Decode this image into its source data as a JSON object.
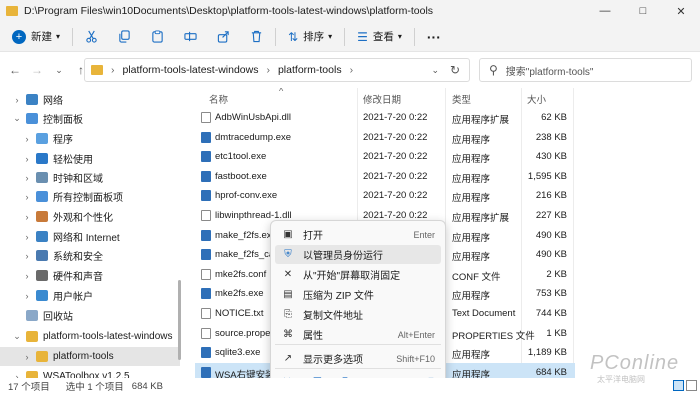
{
  "window": {
    "title": "D:\\Program Files\\win10Documents\\Desktop\\platform-tools-latest-windows\\platform-tools"
  },
  "toolbar": {
    "new_label": "新建",
    "sort_label": "排序",
    "view_label": "查看",
    "more_label": "···"
  },
  "address": {
    "crumb1": "platform-tools-latest-windows",
    "crumb2": "platform-tools",
    "sep": "›",
    "search_placeholder": "搜索\"platform-tools\""
  },
  "sidebar": {
    "items": [
      {
        "label": "网络",
        "color": "#3b82c4",
        "chevron": "›"
      },
      {
        "label": "控制面板",
        "color": "#4a90d9",
        "chevron": "⌄"
      },
      {
        "label": "程序",
        "color": "#5aa0e0",
        "chevron": "›"
      },
      {
        "label": "轻松使用",
        "color": "#2a78c8",
        "chevron": "›"
      },
      {
        "label": "时钟和区域",
        "color": "#6a8fb0",
        "chevron": "›"
      },
      {
        "label": "所有控制面板项",
        "color": "#4a90d9",
        "chevron": "›"
      },
      {
        "label": "外观和个性化",
        "color": "#c87a3a",
        "chevron": "›"
      },
      {
        "label": "网络和 Internet",
        "color": "#3b82c4",
        "chevron": "›"
      },
      {
        "label": "系统和安全",
        "color": "#4a7ab0",
        "chevron": "›"
      },
      {
        "label": "硬件和声音",
        "color": "#6a6a6a",
        "chevron": "›"
      },
      {
        "label": "用户帐户",
        "color": "#3a8ad0",
        "chevron": "›"
      },
      {
        "label": "回收站",
        "color": "#8aa8c8",
        "chevron": ""
      },
      {
        "label": "platform-tools-latest-windows",
        "color": "#e8b43a",
        "chevron": "⌄"
      },
      {
        "label": "platform-tools",
        "color": "#e8b43a",
        "chevron": "›"
      },
      {
        "label": "WSAToolbox v1.2.5",
        "color": "#e8b43a",
        "chevron": "›"
      }
    ]
  },
  "table": {
    "headers": {
      "name": "名称",
      "date": "修改日期",
      "type": "类型",
      "size": "大小"
    },
    "rows": [
      {
        "name": "AdbWinUsbApi.dll",
        "date": "2021-7-20 0:22",
        "type": "应用程序扩展",
        "size": "62 KB"
      },
      {
        "name": "dmtracedump.exe",
        "date": "2021-7-20 0:22",
        "type": "应用程序",
        "size": "238 KB"
      },
      {
        "name": "etc1tool.exe",
        "date": "2021-7-20 0:22",
        "type": "应用程序",
        "size": "430 KB"
      },
      {
        "name": "fastboot.exe",
        "date": "2021-7-20 0:22",
        "type": "应用程序",
        "size": "1,595 KB"
      },
      {
        "name": "hprof-conv.exe",
        "date": "2021-7-20 0:22",
        "type": "应用程序",
        "size": "216 KB"
      },
      {
        "name": "libwinpthread-1.dll",
        "date": "2021-7-20 0:22",
        "type": "应用程序扩展",
        "size": "227 KB"
      },
      {
        "name": "make_f2fs.exe",
        "date": "",
        "type": "应用程序",
        "size": "490 KB"
      },
      {
        "name": "make_f2fs_case",
        "date": "",
        "type": "应用程序",
        "size": "490 KB"
      },
      {
        "name": "mke2fs.conf",
        "date": "",
        "type": "CONF 文件",
        "size": "2 KB"
      },
      {
        "name": "mke2fs.exe",
        "date": "",
        "type": "应用程序",
        "size": "753 KB"
      },
      {
        "name": "NOTICE.txt",
        "date": "",
        "type": "Text Document",
        "size": "744 KB"
      },
      {
        "name": "source.propert",
        "date": "",
        "type": "PROPERTIES 文件",
        "size": "1 KB"
      },
      {
        "name": "sqlite3.exe",
        "date": "",
        "type": "应用程序",
        "size": "1,189 KB"
      },
      {
        "name": "WSA右键安装.exe",
        "date": "",
        "type": "应用程序",
        "size": "684 KB"
      }
    ]
  },
  "context_menu": {
    "items": [
      {
        "label": "打开",
        "key": "Enter",
        "icon": "open-icon"
      },
      {
        "label": "以管理员身份运行",
        "key": "",
        "icon": "shield-icon"
      },
      {
        "label": "从\"开始\"屏幕取消固定",
        "key": "",
        "icon": "unpin-icon"
      },
      {
        "label": "压缩为 ZIP 文件",
        "key": "",
        "icon": "zip-icon"
      },
      {
        "label": "复制文件地址",
        "key": "",
        "icon": "copy-path-icon"
      },
      {
        "label": "属性",
        "key": "Alt+Enter",
        "icon": "properties-icon"
      },
      {
        "label": "显示更多选项",
        "key": "Shift+F10",
        "icon": "more-options-icon"
      }
    ]
  },
  "status": {
    "count": "17 个项目",
    "selected": "选中 1 个项目",
    "size": "684 KB"
  },
  "watermark": {
    "brand": "PConline",
    "sub": "太平洋电脑网"
  },
  "colors": {
    "accent": "#0067c0",
    "selected_row": "#cce4f7",
    "folder": "#e8b43a"
  }
}
